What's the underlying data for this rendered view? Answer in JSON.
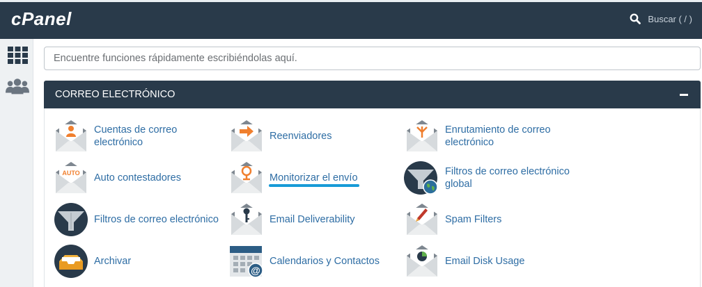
{
  "header": {
    "logo": "cPanel",
    "search_label": "Buscar ( / )"
  },
  "search": {
    "placeholder": "Encuentre funciones rápidamente escribiéndolas aquí."
  },
  "section": {
    "title": "CORREO ELECTRÓNICO",
    "items": [
      {
        "label": "Cuentas de correo electrónico",
        "icon": "email-accounts-icon"
      },
      {
        "label": "Reenviadores",
        "icon": "forwarders-icon"
      },
      {
        "label": "Enrutamiento de correo electrónico",
        "icon": "email-routing-icon"
      },
      {
        "label": "Auto contestadores",
        "icon": "autoresponders-icon",
        "icon_text": "AUTO"
      },
      {
        "label": "Monitorizar el envío",
        "icon": "track-delivery-icon"
      },
      {
        "label": "Filtros de correo electrónico global",
        "icon": "global-email-filters-icon"
      },
      {
        "label": "Filtros de correo electrónico",
        "icon": "email-filters-icon"
      },
      {
        "label": "Email Deliverability",
        "icon": "email-deliverability-icon"
      },
      {
        "label": "Spam Filters",
        "icon": "spam-filters-icon"
      },
      {
        "label": "Archivar",
        "icon": "archive-icon"
      },
      {
        "label": "Calendarios y Contactos",
        "icon": "calendars-contacts-icon"
      },
      {
        "label": "Email Disk Usage",
        "icon": "email-disk-usage-icon"
      }
    ]
  },
  "colors": {
    "header_bg": "#293a4a",
    "link": "#2e6da4",
    "accent_orange": "#f07f2e",
    "active_underline": "#179bd7"
  }
}
